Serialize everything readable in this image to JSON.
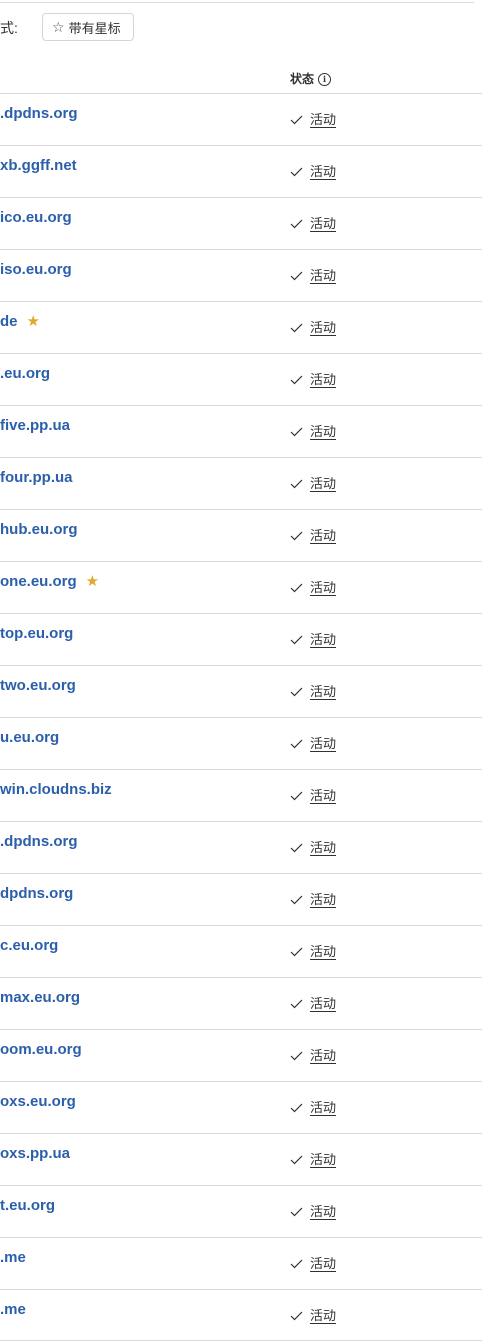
{
  "filter": {
    "label": "式:",
    "starred_button_label": "带有星标",
    "starred_button_icon": "star-outline-icon"
  },
  "table": {
    "status_header": "状态",
    "status_header_icon": "info-icon",
    "rows": [
      {
        "domain": ".dpdns.org",
        "starred": false,
        "status": "活动"
      },
      {
        "domain": "xb.ggff.net",
        "starred": false,
        "status": "活动"
      },
      {
        "domain": "ico.eu.org",
        "starred": false,
        "status": "活动"
      },
      {
        "domain": "iso.eu.org",
        "starred": false,
        "status": "活动"
      },
      {
        "domain": "de",
        "starred": true,
        "status": "活动"
      },
      {
        "domain": ".eu.org",
        "starred": false,
        "status": "活动"
      },
      {
        "domain": "five.pp.ua",
        "starred": false,
        "status": "活动"
      },
      {
        "domain": "four.pp.ua",
        "starred": false,
        "status": "活动"
      },
      {
        "domain": "hub.eu.org",
        "starred": false,
        "status": "活动"
      },
      {
        "domain": "one.eu.org",
        "starred": true,
        "status": "活动"
      },
      {
        "domain": "top.eu.org",
        "starred": false,
        "status": "活动"
      },
      {
        "domain": "two.eu.org",
        "starred": false,
        "status": "活动"
      },
      {
        "domain": "u.eu.org",
        "starred": false,
        "status": "活动"
      },
      {
        "domain": "win.cloudns.biz",
        "starred": false,
        "status": "活动"
      },
      {
        "domain": ".dpdns.org",
        "starred": false,
        "status": "活动"
      },
      {
        "domain": "dpdns.org",
        "starred": false,
        "status": "活动"
      },
      {
        "domain": "c.eu.org",
        "starred": false,
        "status": "活动"
      },
      {
        "domain": "max.eu.org",
        "starred": false,
        "status": "活动"
      },
      {
        "domain": "oom.eu.org",
        "starred": false,
        "status": "活动"
      },
      {
        "domain": "oxs.eu.org",
        "starred": false,
        "status": "活动"
      },
      {
        "domain": "oxs.pp.ua",
        "starred": false,
        "status": "活动"
      },
      {
        "domain": "t.eu.org",
        "starred": false,
        "status": "活动"
      },
      {
        "domain": ".me",
        "starred": false,
        "status": "活动"
      },
      {
        "domain": ".me",
        "starred": false,
        "status": "活动"
      }
    ]
  },
  "colors": {
    "link": "#2b5faa",
    "star": "#e0a82e",
    "divider": "#d9d9d9",
    "text": "#313131"
  }
}
